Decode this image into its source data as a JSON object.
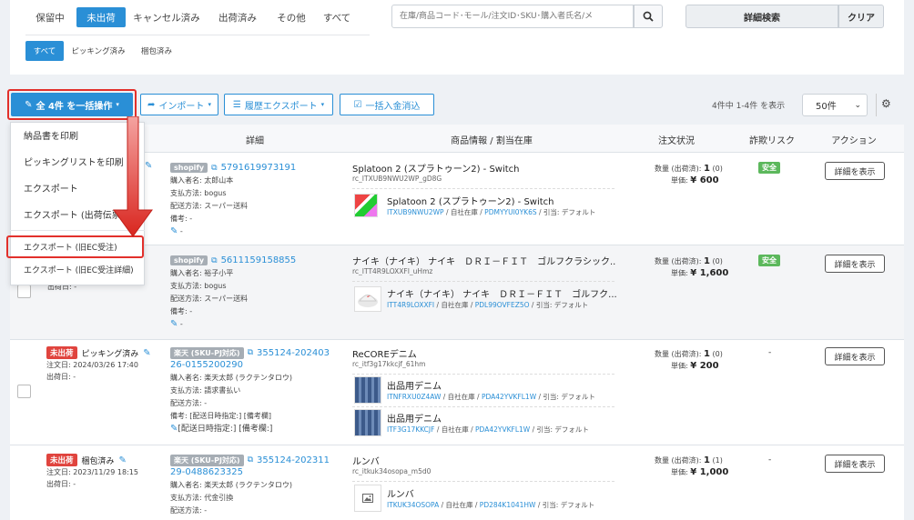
{
  "status_tabs": [
    "保留中",
    "未出荷",
    "キャンセル済み",
    "出荷済み",
    "その他",
    "すべて"
  ],
  "sub_tabs": [
    "すべて",
    "ピッキング済み",
    "梱包済み"
  ],
  "search": {
    "placeholder": "在庫/商品コード･モール/注文ID･SKU･購入者氏名/メ",
    "advanced": "詳細検索",
    "clear": "クリア"
  },
  "toolbar": {
    "bulk": "全 4件 を一括操作",
    "import": "インポート",
    "history_export": "履歴エクスポート",
    "bulk_payment": "一括入金消込",
    "count_text": "4件中 1-4件 を表示",
    "per_page": "50件"
  },
  "bulk_menu": [
    "納品書を印刷",
    "ピッキングリストを印刷",
    "エクスポート",
    "エクスポート (出荷伝票",
    "エクスポート (旧EC受注)",
    "エクスポート (旧EC受注詳細)"
  ],
  "headers": {
    "detail": "詳細",
    "product": "商品情報 / 割当在庫",
    "status": "注文状況",
    "fraud": "詐欺リスク",
    "action": "アクション"
  },
  "labels": {
    "buyer": "購入者名: ",
    "payment": "支払方法: ",
    "delivery": "配送方法: ",
    "remarks": "備考: ",
    "order_date": "注文日: ",
    "ship_date": "出荷日: ",
    "qty": "数量 (出荷済): ",
    "unit": "単価: ",
    "view": "詳細を表示",
    "own_stock": "自社在庫",
    "alloc": "引当: デフォルト"
  },
  "orders": [
    {
      "source": "shopify",
      "order_id": "5791619973191",
      "buyer": "太郎山本",
      "payment": "bogus",
      "delivery": "スーパー送料",
      "remarks": "-",
      "product_title": "Splatoon 2 (スプラトゥーン2) - Switch",
      "product_sku": "rc_ITXUB9NWU2WP_gD8G",
      "qty": "1",
      "shipped": "(0)",
      "price": "¥ 600",
      "fraud": "安全",
      "items": [
        {
          "name": "Splatoon 2 (スプラトゥーン2) - Switch",
          "code": "ITXUB9NWU2WP",
          "stock_code": "PDMYYUI0YK6S"
        }
      ]
    },
    {
      "source": "shopify",
      "order_id": "5611159158855",
      "buyer": "裕子小平",
      "payment": "bogus",
      "delivery": "スーパー送料",
      "remarks": "-",
      "ship_date": "-",
      "product_title": "ナイキ（ナイキ） ナイキ　ＤＲＩ－ＦＩＴ　ゴルフクラシック...",
      "product_sku": "rc_ITT4R9LOXXFI_uHmz",
      "qty": "1",
      "shipped": "(0)",
      "price": "¥ 1,600",
      "fraud": "安全",
      "items": [
        {
          "name": "ナイキ（ナイキ） ナイキ　ＤＲＩ－ＦＩＴ　ゴルフク...",
          "code": "ITT4R9LOXXFI",
          "stock_code": "PDL99OVFEZ5O"
        }
      ]
    },
    {
      "status": "未出荷",
      "sub_status": "ピッキング済み",
      "order_date": "2024/03/26 17:40",
      "ship_date": "-",
      "source": "楽天 (SKU-PJ対応)",
      "order_id_line1": "355124-202403",
      "order_id_line2": "26-0155200290",
      "buyer": "楽天太郎 (ラクテンタロウ)",
      "payment": "請求書払い",
      "delivery": "-",
      "remarks": "[配送日時指定:] [備考欄]",
      "remarks_note": "[配送日時指定:] [備考欄:]",
      "product_title": "ReCOREデニム",
      "product_sku": "rc_itf3g17kkcjf_61hm",
      "qty": "1",
      "shipped": "(0)",
      "price": "¥ 200",
      "fraud": "-",
      "items": [
        {
          "name": "出品用デニム",
          "code": "ITNFRXU0Z4AW",
          "stock_code": "PDA42YVKFL1W"
        },
        {
          "name": "出品用デニム",
          "code": "ITF3G17KKCJF",
          "stock_code": "PDA42YVKFL1W"
        }
      ]
    },
    {
      "status": "未出荷",
      "sub_status": "梱包済み",
      "order_date": "2023/11/29 18:15",
      "ship_date": "-",
      "source": "楽天 (SKU-PJ対応)",
      "order_id_line1": "355124-202311",
      "order_id_line2": "29-0488623325",
      "buyer": "楽天太郎 (ラクテンタロウ)",
      "payment": "代金引換",
      "delivery": "-",
      "product_title": "ルンバ",
      "product_sku": "rc_itkuk34osopa_m5d0",
      "qty": "1",
      "shipped": "(1)",
      "price": "¥ 1,000",
      "fraud": "-",
      "items": [
        {
          "name": "ルンバ",
          "code": "ITKUK34OSOPA",
          "stock_code": "PD284K1041HW"
        }
      ]
    }
  ],
  "colors": {
    "primary": "#2a8fd6",
    "danger": "#e0443e",
    "success": "#5cb85c"
  }
}
